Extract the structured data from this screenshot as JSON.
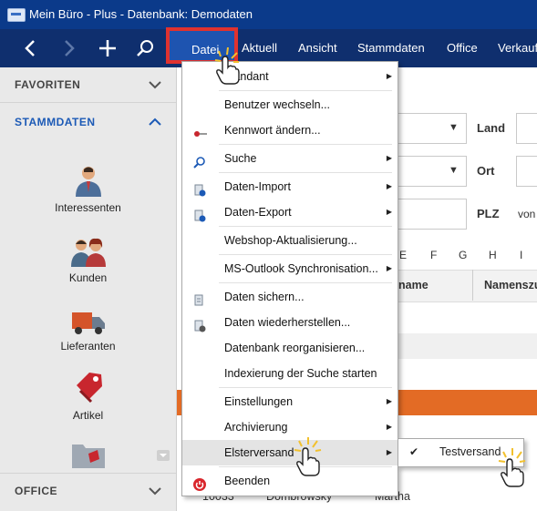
{
  "window": {
    "title": "Mein Büro - Plus - Datenbank: Demodaten"
  },
  "menubar": {
    "items": [
      "Datei",
      "Aktuell",
      "Ansicht",
      "Stammdaten",
      "Office",
      "Verkauf"
    ]
  },
  "sidebar": {
    "favoriten": "FAVORITEN",
    "stammdaten": "STAMMDATEN",
    "items": [
      "Interessenten",
      "Kunden",
      "Lieferanten",
      "Artikel"
    ],
    "office": "OFFICE"
  },
  "main": {
    "land_label": "Land",
    "ort_label": "Ort",
    "plz_label": "PLZ",
    "von_label": "von",
    "letters": [
      "E",
      "F",
      "G",
      "H",
      "I"
    ],
    "col_name": "name",
    "col_namenszu": "Namenszu",
    "row": {
      "nr": "10033",
      "name": "Dombrowsky",
      "vorname": "Martha"
    }
  },
  "dropdown": {
    "items": [
      {
        "label": "Mandant",
        "submenu": true
      },
      {
        "label": "Benutzer wechseln...",
        "submenu": false
      },
      {
        "label": "Kennwort ändern...",
        "submenu": false,
        "icon": "key-icon"
      },
      {
        "label": "Suche",
        "submenu": true,
        "icon": "search-icon"
      },
      {
        "label": "Daten-Import",
        "submenu": true,
        "icon": "import-icon"
      },
      {
        "label": "Daten-Export",
        "submenu": true,
        "icon": "export-icon"
      },
      {
        "label": "Webshop-Aktualisierung...",
        "submenu": false
      },
      {
        "label": "MS-Outlook Synchronisation...",
        "submenu": true
      },
      {
        "label": "Daten sichern...",
        "submenu": false,
        "icon": "backup-icon"
      },
      {
        "label": "Daten wiederherstellen...",
        "submenu": false,
        "icon": "restore-icon"
      },
      {
        "label": "Datenbank reorganisieren...",
        "submenu": false
      },
      {
        "label": "Indexierung der Suche starten",
        "submenu": false
      },
      {
        "label": "Einstellungen",
        "submenu": true
      },
      {
        "label": "Archivierung",
        "submenu": true
      },
      {
        "label": "Elsterversand",
        "submenu": true
      },
      {
        "label": "Beenden",
        "submenu": false,
        "icon": "power-icon"
      }
    ],
    "submenu_elster": {
      "checked": true,
      "label": "Testversand"
    }
  }
}
